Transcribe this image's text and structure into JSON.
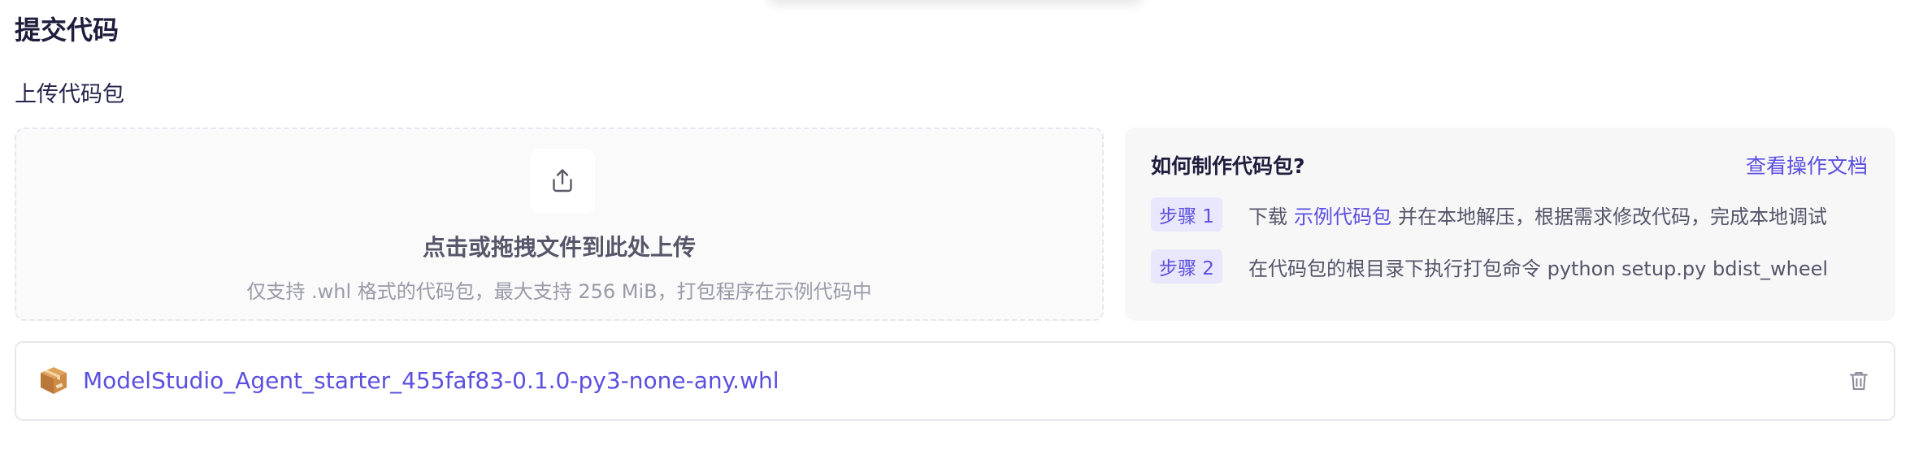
{
  "section": {
    "title": "提交代码",
    "subtitle": "上传代码包"
  },
  "upload": {
    "title": "点击或拖拽文件到此处上传",
    "hint": "仅支持 .whl 格式的代码包，最大支持 256 MiB，打包程序在示例代码中",
    "icon": "upload-icon"
  },
  "guide": {
    "title": "如何制作代码包?",
    "doc_link": "查看操作文档",
    "steps": [
      {
        "badge": "步骤 1",
        "prefix": "下载",
        "link": "示例代码包",
        "suffix": "并在本地解压，根据需求修改代码，完成本地调试"
      },
      {
        "badge": "步骤 2",
        "text": "在代码包的根目录下执行打包命令 python setup.py bdist_wheel"
      }
    ]
  },
  "file": {
    "name": "ModelStudio_Agent_starter_455faf83-0.1.0-py3-none-any.whl",
    "icon": "package-icon",
    "delete_icon": "trash-icon"
  },
  "colors": {
    "accent": "#5b4fe0",
    "badge_bg": "#e9e7fb",
    "panel_bg": "#f7f7f8"
  }
}
